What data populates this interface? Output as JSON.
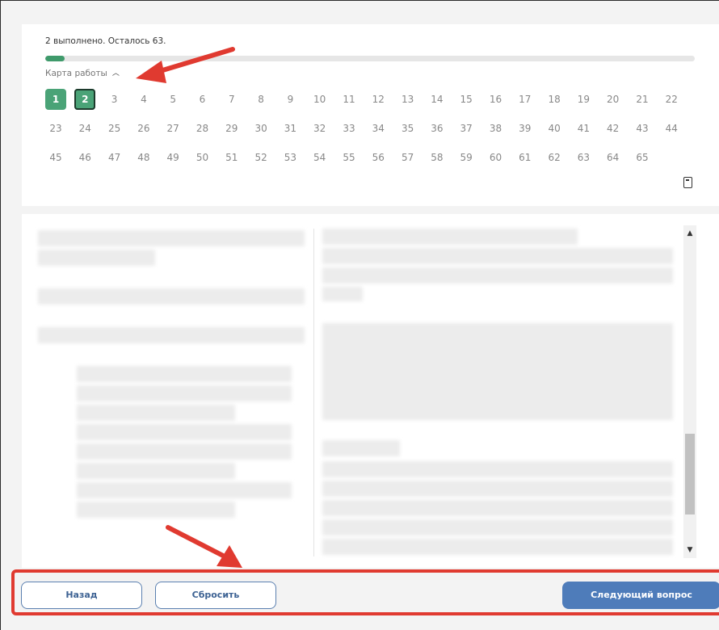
{
  "progress": {
    "text": "2 выполнено. Осталось 63.",
    "fraction": 0.03
  },
  "work_map": {
    "label": "Карта работы",
    "chevron_icon": "chevron-up-icon",
    "questions": [
      "1",
      "2",
      "3",
      "4",
      "5",
      "6",
      "7",
      "8",
      "9",
      "10",
      "11",
      "12",
      "13",
      "14",
      "15",
      "16",
      "17",
      "18",
      "19",
      "20",
      "21",
      "22",
      "23",
      "24",
      "25",
      "26",
      "27",
      "28",
      "29",
      "30",
      "31",
      "32",
      "33",
      "34",
      "35",
      "36",
      "37",
      "38",
      "39",
      "40",
      "41",
      "42",
      "43",
      "44",
      "45",
      "46",
      "47",
      "48",
      "49",
      "50",
      "51",
      "52",
      "53",
      "54",
      "55",
      "56",
      "57",
      "58",
      "59",
      "60",
      "61",
      "62",
      "63",
      "64",
      "65"
    ],
    "completed": [
      "1",
      "2"
    ],
    "current": "2",
    "calculator_icon": "calculator-icon"
  },
  "colors": {
    "done": "#4aa377",
    "accent_blue": "#4e7cba",
    "annotation_red": "#e03a30"
  },
  "footer": {
    "back_label": "Назад",
    "reset_label": "Сбросить",
    "next_label": "Следующий вопрос"
  }
}
